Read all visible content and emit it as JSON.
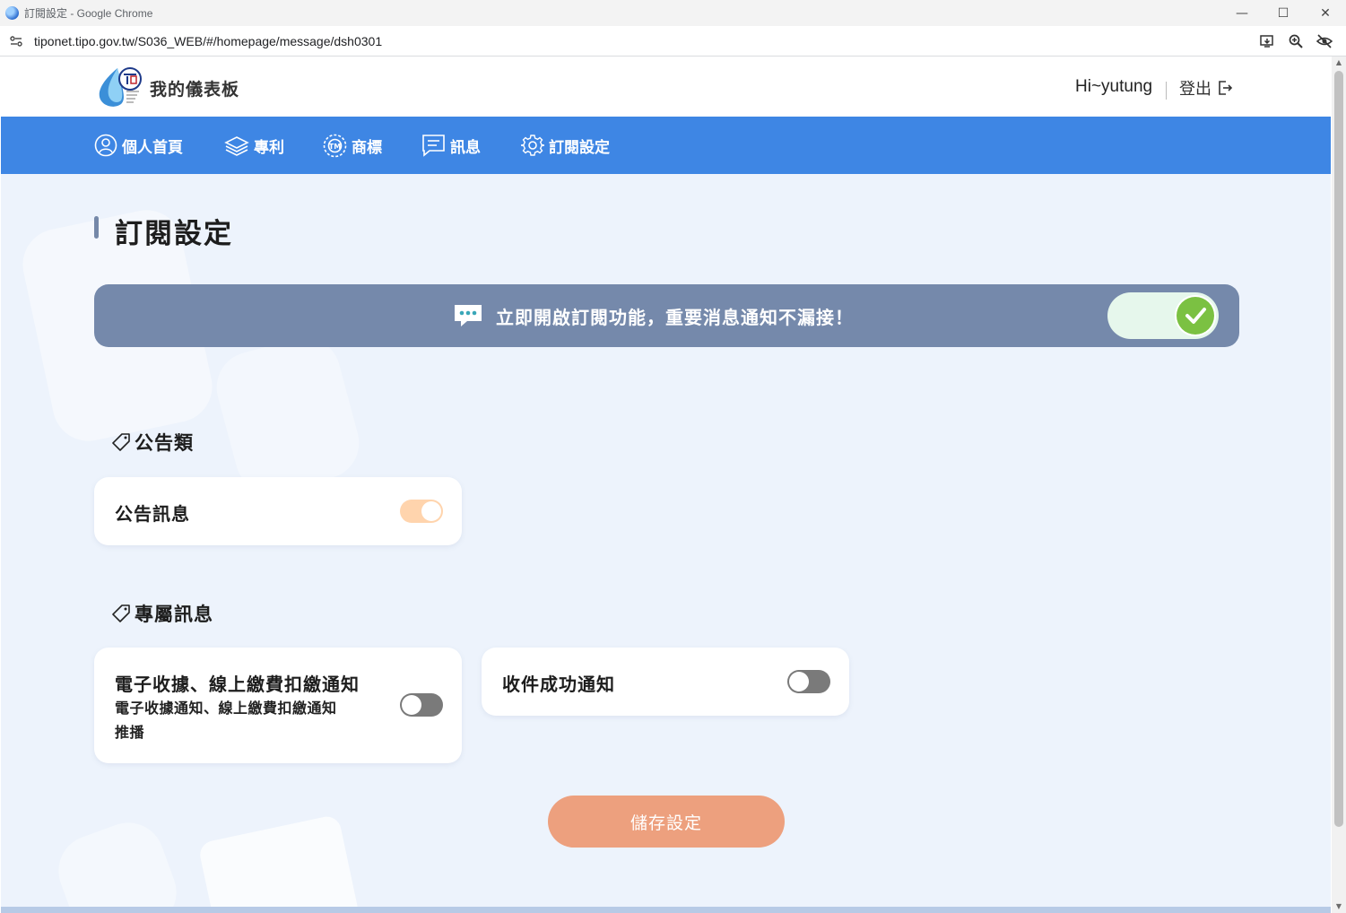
{
  "window": {
    "title": "訂閱設定 - Google Chrome",
    "minimize_icon": "—",
    "maximize_icon": "☐",
    "close_icon": "✕"
  },
  "browser": {
    "url": "tiponet.tipo.gov.tw/S036_WEB/#/homepage/message/dsh0301"
  },
  "header": {
    "dashboard_title": "我的儀表板",
    "greeting": "Hi~yutung",
    "logout_label": "登出"
  },
  "nav": {
    "items": [
      {
        "label": "個人首頁",
        "icon": "user-icon"
      },
      {
        "label": "專利",
        "icon": "patent-icon"
      },
      {
        "label": "商標",
        "icon": "trademark-icon"
      },
      {
        "label": "訊息",
        "icon": "message-icon"
      },
      {
        "label": "訂閱設定",
        "icon": "gear-icon"
      }
    ]
  },
  "page": {
    "title": "訂閱設定",
    "banner_text": "立即開啟訂閱功能，重要消息通知不漏接！",
    "master_subscription_on": true
  },
  "sections": [
    {
      "title": "公告類",
      "cards": [
        {
          "title": "公告訊息",
          "desc": "",
          "enabled": true
        }
      ]
    },
    {
      "title": "專屬訊息",
      "cards": [
        {
          "title": "電子收據、線上繳費扣繳通知",
          "desc_line1": "電子收據通知、線上繳費扣繳通知",
          "desc_line2": "推播",
          "enabled": false
        },
        {
          "title": "收件成功通知",
          "desc": "",
          "enabled": false
        }
      ]
    }
  ],
  "actions": {
    "save_label": "儲存設定"
  },
  "colors": {
    "nav_bg": "#3e86e4",
    "banner_bg": "#7589ab",
    "toggle_on": "#ffd4ad",
    "toggle_off": "#7a7a7a",
    "save_button": "#eda07e",
    "check_green": "#7bc142"
  }
}
